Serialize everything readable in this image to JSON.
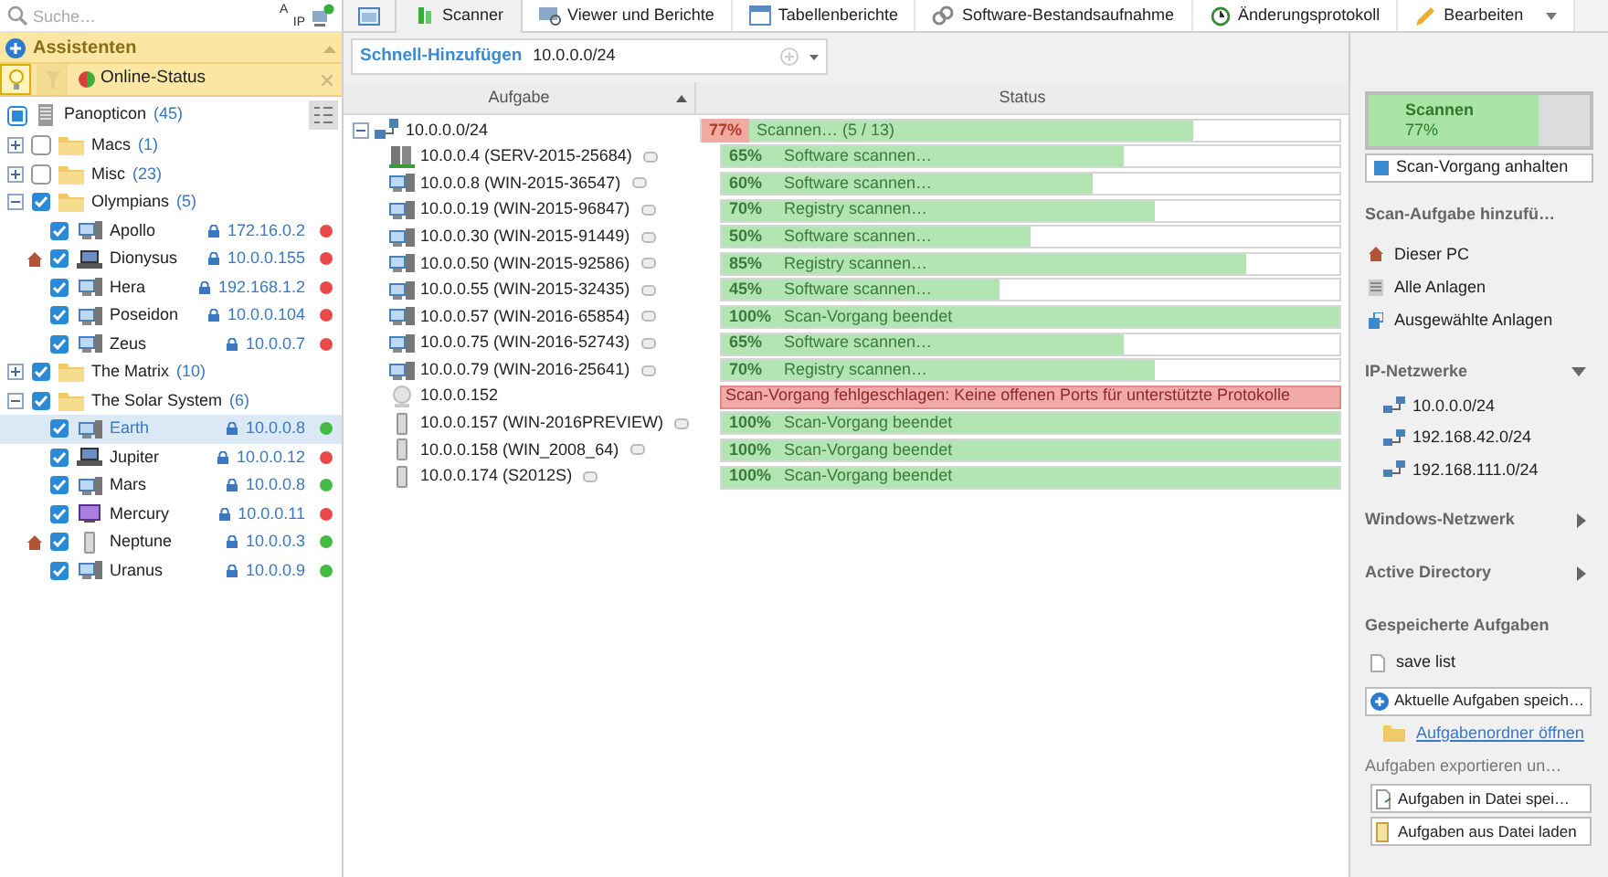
{
  "sidebar": {
    "search": {
      "placeholder": "Suche…"
    },
    "sort_toggle": {
      "top": "A",
      "bottom": "IP"
    },
    "assistant": {
      "title": "Assistenten",
      "filter": {
        "label": "Online-Status",
        "bulb_selected": true,
        "filter_selected": false
      }
    },
    "tree": {
      "label": "Panopticon",
      "count": "(45)",
      "partial": true,
      "children": [
        {
          "label": "Macs",
          "count": "(1)",
          "checked": false,
          "expanded": false
        },
        {
          "label": "Misc",
          "count": "(23)",
          "checked": false,
          "expanded": false
        },
        {
          "label": "Olympians",
          "count": "(5)",
          "checked": true,
          "expanded": true,
          "children": [
            {
              "label": "Apollo",
              "ip": "172.16.0.2",
              "kind": "desktop",
              "home": false,
              "selected": false,
              "checked": true,
              "color": "#e84a4a"
            },
            {
              "label": "Dionysus",
              "ip": "10.0.0.155",
              "kind": "laptop",
              "home": true,
              "selected": false,
              "checked": true,
              "color": "#e84a4a"
            },
            {
              "label": "Hera",
              "ip": "192.168.1.2",
              "kind": "desktop",
              "home": false,
              "selected": false,
              "checked": true,
              "color": "#e84a4a"
            },
            {
              "label": "Poseidon",
              "ip": "10.0.0.104",
              "kind": "desktop",
              "home": false,
              "selected": false,
              "checked": true,
              "color": "#e84a4a"
            },
            {
              "label": "Zeus",
              "ip": "10.0.0.7",
              "kind": "desktop",
              "home": false,
              "selected": false,
              "checked": true,
              "color": "#e84a4a"
            }
          ]
        },
        {
          "label": "The Matrix",
          "count": "(10)",
          "checked": true,
          "expanded": false
        },
        {
          "label": "The Solar System",
          "count": "(6)",
          "checked": true,
          "expanded": true,
          "children": [
            {
              "label": "Earth",
              "ip": "10.0.0.8",
              "kind": "desktop",
              "home": false,
              "selected": true,
              "checked": true,
              "color": "#44bb44"
            },
            {
              "label": "Jupiter",
              "ip": "10.0.0.12",
              "kind": "laptop",
              "home": false,
              "selected": false,
              "checked": true,
              "color": "#e84a4a"
            },
            {
              "label": "Mars",
              "ip": "10.0.0.8",
              "kind": "desktop",
              "home": false,
              "selected": false,
              "checked": true,
              "color": "#44bb44"
            },
            {
              "label": "Mercury",
              "ip": "10.0.0.11",
              "kind": "media",
              "home": false,
              "selected": false,
              "checked": true,
              "color": "#e84a4a"
            },
            {
              "label": "Neptune",
              "ip": "10.0.0.3",
              "kind": "tower",
              "home": true,
              "selected": false,
              "checked": true,
              "color": "#44bb44"
            },
            {
              "label": "Uranus",
              "ip": "10.0.0.9",
              "kind": "desktop",
              "home": false,
              "selected": false,
              "checked": true,
              "color": "#44bb44"
            }
          ]
        }
      ]
    }
  },
  "tabs": [
    {
      "label": "Scanner",
      "selected": true
    },
    {
      "label": "Viewer und Berichte",
      "selected": false
    },
    {
      "label": "Tabellenberichte",
      "selected": false
    },
    {
      "label": "Software-Bestandsaufnahme",
      "selected": false
    },
    {
      "label": "Änderungsprotokoll",
      "selected": false
    },
    {
      "label": "Bearbeiten",
      "selected": false
    }
  ],
  "quick_add": {
    "label": "Schnell-Hinzufügen",
    "value": "10.0.0.0/24"
  },
  "table": {
    "columns": [
      "Aufgabe",
      "Status"
    ],
    "root": {
      "task": "10.0.0.0/24",
      "percent": "77%",
      "status": "Scannen… (5 / 13)",
      "level": 0.77,
      "expanded": true
    },
    "rows": [
      {
        "task": "10.0.0.4 (SERV-2015-25684)",
        "kind": "server",
        "percent": "65%",
        "status": "Software scannen…",
        "level": 0.65
      },
      {
        "task": "10.0.0.8 (WIN-2015-36547)",
        "kind": "workstation",
        "percent": "60%",
        "status": "Software scannen…",
        "level": 0.6
      },
      {
        "task": "10.0.0.19 (WIN-2015-96847)",
        "kind": "workstation",
        "percent": "70%",
        "status": "Registry scannen…",
        "level": 0.7
      },
      {
        "task": "10.0.0.30 (WIN-2015-91449)",
        "kind": "workstation",
        "percent": "50%",
        "status": "Software scannen…",
        "level": 0.5
      },
      {
        "task": "10.0.0.50 (WIN-2015-92586)",
        "kind": "workstation",
        "percent": "85%",
        "status": "Registry scannen…",
        "level": 0.85
      },
      {
        "task": "10.0.0.55 (WIN-2015-32435)",
        "kind": "workstation",
        "percent": "45%",
        "status": "Software scannen…",
        "level": 0.45
      },
      {
        "task": "10.0.0.57 (WIN-2016-65854)",
        "kind": "workstation",
        "percent": "100%",
        "status": "Scan-Vorgang beendet",
        "level": 1
      },
      {
        "task": "10.0.0.75 (WIN-2016-52743)",
        "kind": "workstation",
        "percent": "65%",
        "status": "Software scannen…",
        "level": 0.65
      },
      {
        "task": "10.0.0.79 (WIN-2016-25641)",
        "kind": "workstation",
        "percent": "70%",
        "status": "Registry scannen…",
        "level": 0.7
      },
      {
        "task": "10.0.0.152",
        "kind": "unknown",
        "status": "Scan-Vorgang fehlgeschlagen: Keine offenen Ports für unterstützte Protokolle"
      },
      {
        "task": "10.0.0.157 (WIN-2016PREVIEW)",
        "kind": "tower",
        "percent": "100%",
        "status": "Scan-Vorgang beendet",
        "level": 1
      },
      {
        "task": "10.0.0.158 (WIN_2008_64)",
        "kind": "tower",
        "percent": "100%",
        "status": "Scan-Vorgang beendet",
        "level": 1
      },
      {
        "task": "10.0.0.174 (S2012S)",
        "kind": "tower",
        "percent": "100%",
        "status": "Scan-Vorgang beendet",
        "level": 1
      }
    ]
  },
  "panel": {
    "scan": {
      "title": "Scannen",
      "percent": "77%",
      "level": 0.77
    },
    "stop_button": "Scan-Vorgang anhalten",
    "add_heading": "Scan-Aufgabe hinzufü…",
    "add_items": [
      {
        "label": "Dieser PC",
        "kind": "home"
      },
      {
        "label": "Alle Anlagen",
        "kind": "list"
      },
      {
        "label": "Ausgewählte Anlagen",
        "kind": "selected"
      }
    ],
    "sections": [
      {
        "title": "IP-Netzwerke",
        "expanded": true,
        "items": [
          "10.0.0.0/24",
          "192.168.42.0/24",
          "192.168.111.0/24"
        ]
      },
      {
        "title": "Windows-Netzwerk",
        "expanded": false
      },
      {
        "title": "Active Directory",
        "expanded": false
      }
    ],
    "saved_heading": "Gespeicherte Aufgaben",
    "saved_items": [
      "save list"
    ],
    "save_button": "Aktuelle Aufgaben speich…",
    "open_link": "Aufgabenordner öffnen",
    "export_heading": "Aufgaben exportieren un…",
    "export_buttons": [
      {
        "label": "Aufgaben in Datei spei…",
        "kind": "export"
      },
      {
        "label": "Aufgaben aus Datei laden",
        "kind": "import"
      }
    ]
  }
}
